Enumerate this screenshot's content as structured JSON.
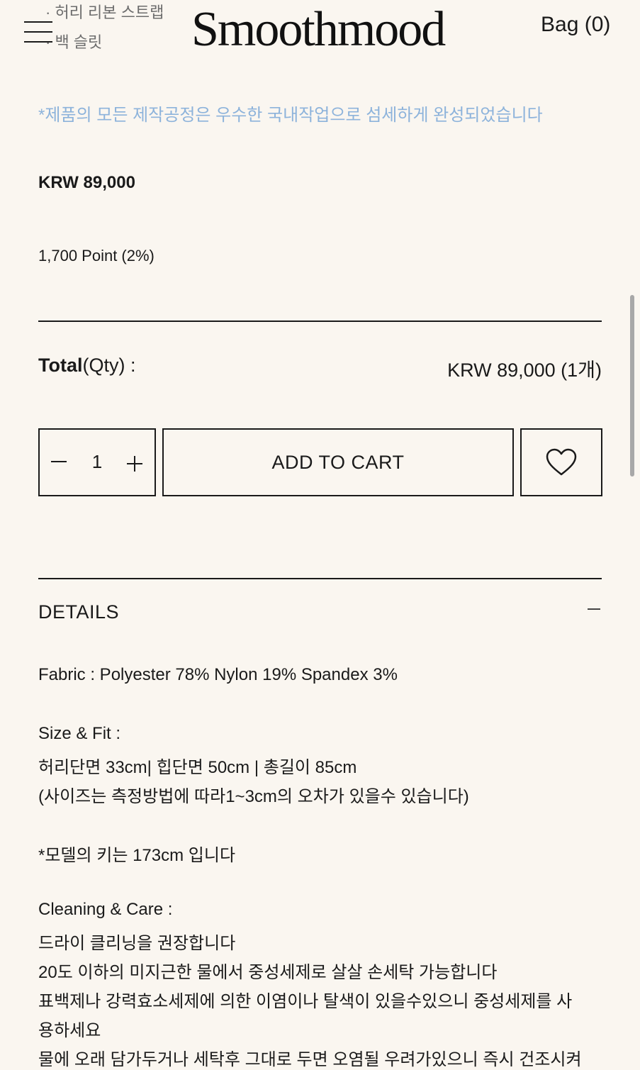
{
  "header": {
    "background_lines": [
      "· 허리 리본 스트랩",
      "· 백 슬릿"
    ],
    "logo": "Smoothmood",
    "bag_label": "Bag (0)"
  },
  "product": {
    "notice": "*제품의 모든 제작공정은 우수한 국내작업으로 섬세하게 완성되었습니다",
    "price": "KRW 89,000",
    "points": "1,700 Point (2%)"
  },
  "total": {
    "label_bold": "Total",
    "label_rest": "(Qty) :",
    "value": "KRW 89,000 (1개)"
  },
  "purchase": {
    "quantity": "1",
    "add_to_cart": "ADD TO CART"
  },
  "details": {
    "title": "DETAILS",
    "fabric": "Fabric : Polyester 78% Nylon 19% Spandex 3%",
    "size_title": "Size & Fit :",
    "size_line1": "허리단면 33cm| 힙단면 50cm | 총길이 85cm",
    "size_line2": "(사이즈는 측정방법에 따라1~3cm의 오차가 있을수 있습니다)",
    "model": "*모델의 키는 173cm 입니다",
    "care_title": "Cleaning & Care :",
    "care_line1": "드라이 클리닝을 권장합니다",
    "care_line2": "20도 이하의 미지근한 물에서 중성세제로 살살 손세탁 가능합니다",
    "care_line3": "표백제나 강력효소세제에 의한 이염이나 탈색이 있을수있으니 중성세제를 사",
    "care_line4": "용하세요",
    "care_line5": "물에 오래 담가두거나 세탁후 그대로 두면 오염될 우려가있으니 즉시 건조시켜"
  },
  "icons": {
    "menu": "menu-icon",
    "minus": "minus-icon",
    "plus": "plus-icon",
    "heart": "heart-icon",
    "collapse": "collapse-icon"
  },
  "colors": {
    "background": "#faf6f0",
    "notice": "#8db3db",
    "text": "#1a1a1a"
  }
}
